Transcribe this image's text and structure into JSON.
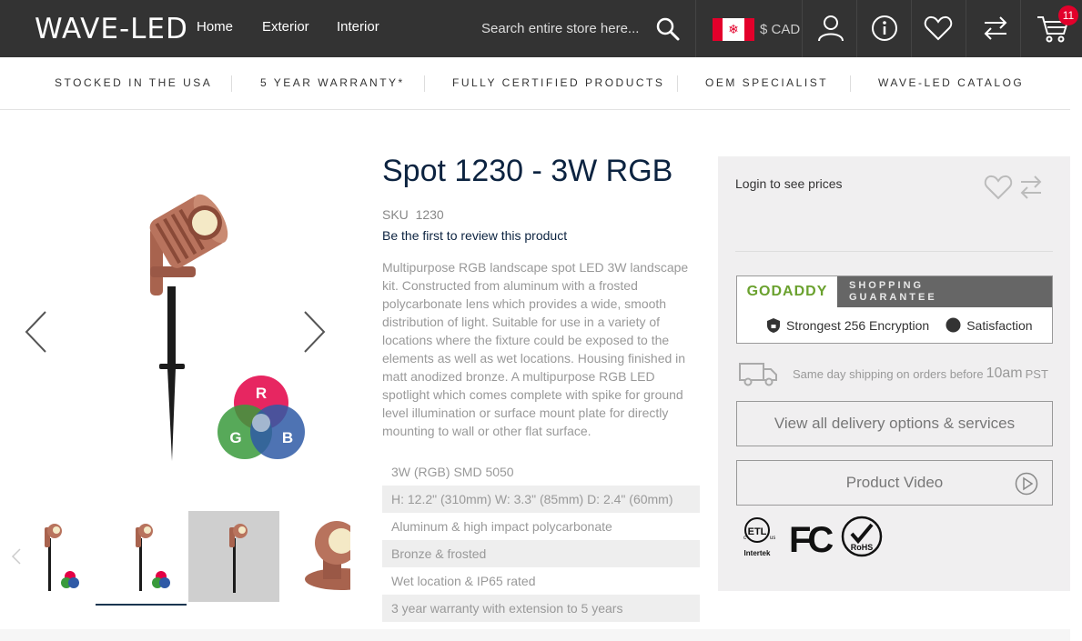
{
  "header": {
    "logo": "WAVE-LED",
    "nav": [
      "Home",
      "Exterior",
      "Interior"
    ],
    "search_placeholder": "Search entire store here...",
    "currency": "$ CAD",
    "cart_count": "11"
  },
  "usp": [
    "Stocked in the USA",
    "5 Year Warranty*",
    "Fully Certified Products",
    "OEM Specialist",
    "Wave-LED Catalog"
  ],
  "product": {
    "title": "Spot 1230 - 3W RGB",
    "sku_label": "SKU",
    "sku": "1230",
    "review_link": "Be the first to review this product",
    "description": "Multipurpose RGB landscape spot LED 3W landscape kit. Constructed from aluminum with a frosted polycarbonate lens which provides a wide, smooth distribution of light. Suitable for use in a variety of locations where the fixture could be exposed to the elements as well as wet locations. Housing finished in matt anodized bronze. A multipurpose RGB LED spotlight which comes complete with spike for ground level illumination or surface mount plate for directly mounting to wall or other flat surface.",
    "specs": [
      "3W (RGB) SMD 5050",
      "H: 12.2\" (310mm) W: 3.3\" (85mm) D: 2.4\" (60mm)",
      "Aluminum & high impact polycarbonate",
      "Bronze & frosted",
      "Wet location & IP65 rated",
      "3 year warranty with extension to 5 years"
    ],
    "rgb_letters": [
      "R",
      "G",
      "B"
    ]
  },
  "sidebar": {
    "login": "Login to see prices",
    "godaddy": "GODADDY",
    "godaddy_guarantee_1": "SHOPPING",
    "godaddy_guarantee_2": "GUARANTEE",
    "encryption": "Strongest 256 Encryption",
    "satisfaction": "Satisfaction",
    "ship_text_1": "Same day shipping on orders before",
    "ship_time": "10am",
    "ship_tz": "PST",
    "delivery_btn": "View all delivery options & services",
    "video_btn": "Product Video",
    "cert_etl": "Intertek",
    "cert_etl_logo": "ETL",
    "cert_c": "c",
    "cert_us": "us",
    "cert_fc": "FC",
    "cert_rohs": "RoHS"
  },
  "colors": {
    "header_bg": "#333333",
    "accent_red": "#e3002b",
    "title_navy": "#0c2340",
    "bronze": "#b0705a"
  }
}
